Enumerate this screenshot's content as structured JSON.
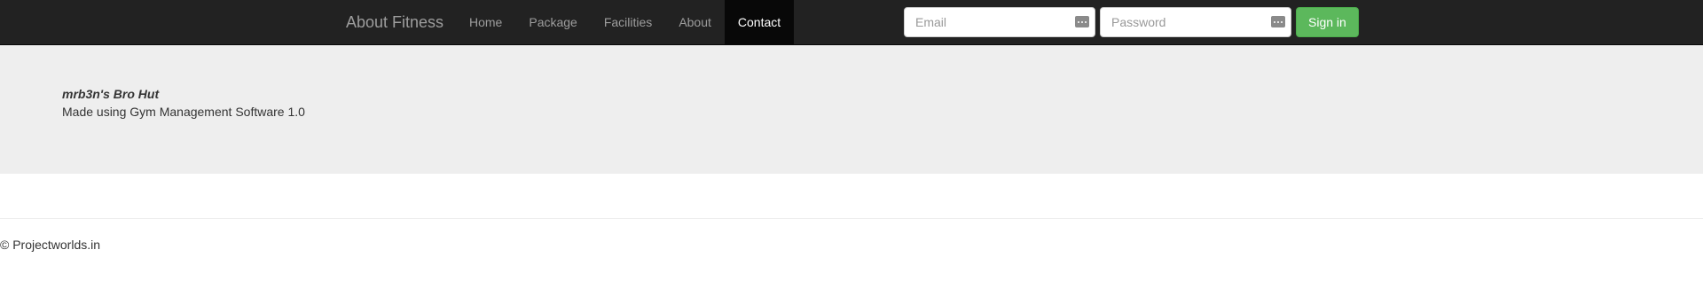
{
  "navbar": {
    "brand": "About Fitness",
    "items": [
      {
        "label": "Home",
        "active": false
      },
      {
        "label": "Package",
        "active": false
      },
      {
        "label": "Facilities",
        "active": false
      },
      {
        "label": "About",
        "active": false
      },
      {
        "label": "Contact",
        "active": true
      }
    ]
  },
  "signin": {
    "email_placeholder": "Email",
    "email_value": "",
    "password_placeholder": "Password",
    "password_value": "",
    "button_label": "Sign in",
    "field_icon": "password-manager-key-icon"
  },
  "jumbotron": {
    "site_name": "mrb3n's Bro Hut",
    "made_using": "Made using Gym Management Software 1.0"
  },
  "footer": {
    "copyright": "© Projectworlds.in"
  },
  "colors": {
    "navbar_bg": "#222222",
    "nav_active_bg": "#080808",
    "nav_text": "#9d9d9d",
    "nav_active_text": "#ffffff",
    "signin_button": "#5cb85c",
    "jumbotron_bg": "#eeeeee"
  }
}
